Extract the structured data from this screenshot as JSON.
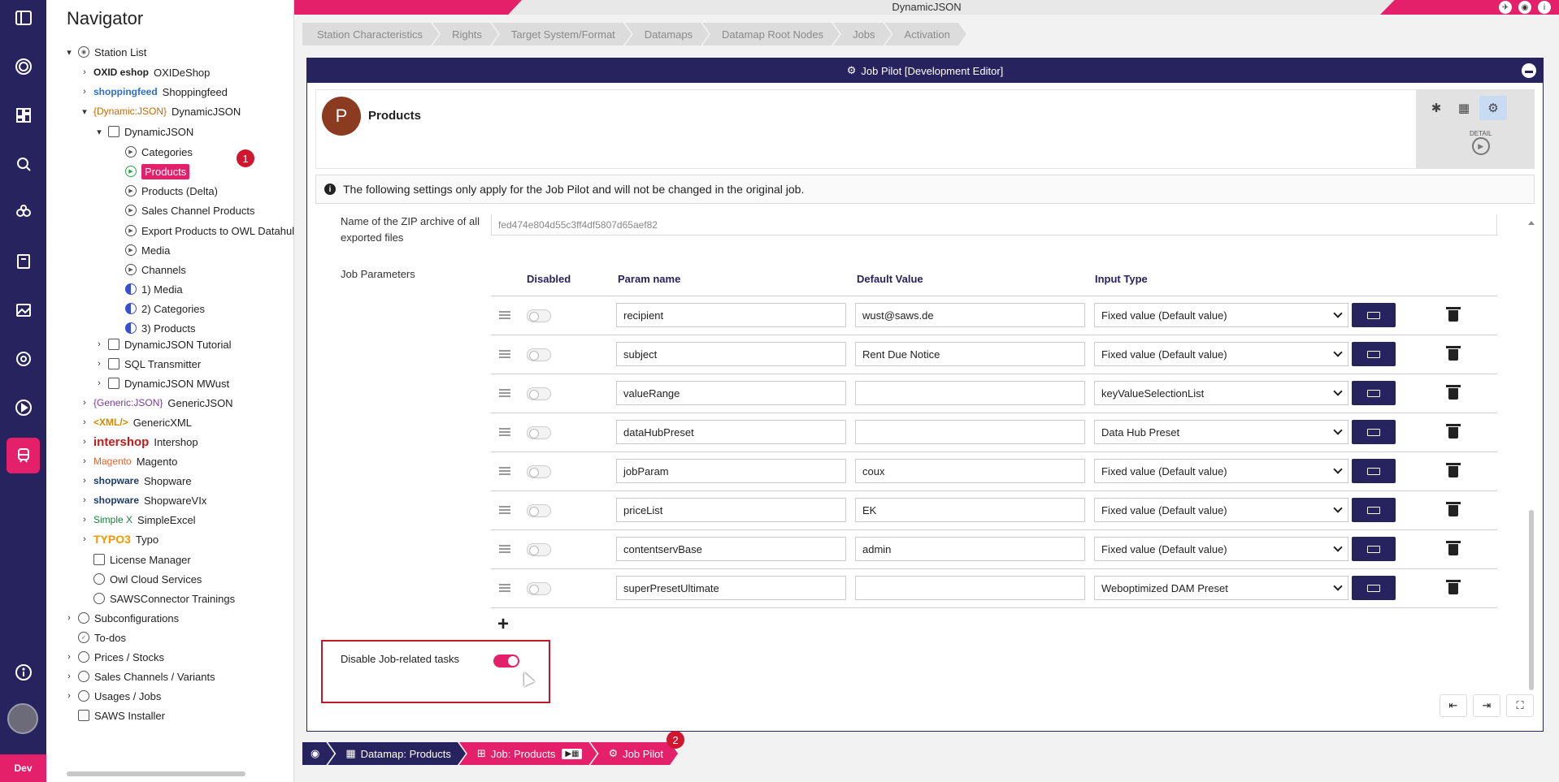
{
  "rail": {
    "icons": [
      "collapse-icon",
      "logo-icon",
      "dashboard-icon",
      "search-icon",
      "connections-icon",
      "book-icon",
      "image-icon",
      "settings-icon",
      "play-icon",
      "station-icon",
      "info-icon"
    ],
    "env": "Dev"
  },
  "nav": {
    "title": "Navigator",
    "items": [
      {
        "label": "Station List"
      },
      {
        "brand": "OXID eshop",
        "label": "OXIDeShop"
      },
      {
        "brand": "shoppingfeed",
        "label": "Shoppingfeed"
      },
      {
        "brand": "{Dynamic:JSON}",
        "label": "DynamicJSON"
      },
      {
        "label": "DynamicJSON"
      },
      {
        "label": "Categories"
      },
      {
        "label": "Products"
      },
      {
        "label": "Products (Delta)"
      },
      {
        "label": "Sales Channel Products"
      },
      {
        "label": "Export Products to OWL Datahul"
      },
      {
        "label": "Media"
      },
      {
        "label": "Channels"
      },
      {
        "label": "1) Media"
      },
      {
        "label": "2) Categories"
      },
      {
        "label": "3) Products"
      },
      {
        "label": "DynamicJSON Tutorial"
      },
      {
        "label": "SQL Transmitter"
      },
      {
        "label": "DynamicJSON MWust"
      },
      {
        "brand": "{Generic:JSON}",
        "label": "GenericJSON"
      },
      {
        "brand": "<XML/>",
        "label": "GenericXML"
      },
      {
        "brand": "intershop",
        "label": "Intershop"
      },
      {
        "brand": "Magento",
        "label": "Magento"
      },
      {
        "brand": "shopware",
        "label": "Shopware"
      },
      {
        "brand": "shopware",
        "label": "ShopwareVIx"
      },
      {
        "brand": "Simple X",
        "label": "SimpleExcel"
      },
      {
        "brand": "TYPO3",
        "label": "Typo"
      },
      {
        "label": "License Manager"
      },
      {
        "label": "Owl Cloud Services"
      },
      {
        "label": "SAWSConnector Trainings"
      },
      {
        "label": "Subconfigurations"
      },
      {
        "label": "To-dos"
      },
      {
        "label": "Prices / Stocks"
      },
      {
        "label": "Sales Channels / Variants"
      },
      {
        "label": "Usages / Jobs"
      },
      {
        "label": "SAWS Installer"
      }
    ],
    "badge1": "1"
  },
  "top": {
    "title": "DynamicJSON"
  },
  "steps": [
    "Station Characteristics",
    "Rights",
    "Target System/Format",
    "Datamaps",
    "Datamap Root Nodes",
    "Jobs",
    "Activation"
  ],
  "panel": {
    "title": "Job Pilot [Development Editor]",
    "job_initial": "P",
    "job_name": "Products",
    "detail_label": "DETAIL",
    "info": "The following settings only apply for the Job Pilot and will not be changed in the original job.",
    "zip_label": "Name of the ZIP archive of all exported files",
    "zip_value": "fed474e804d55c3ff4df5807d65aef82",
    "params_label": "Job Parameters",
    "columns": {
      "disabled": "Disabled",
      "name": "Param name",
      "default": "Default Value",
      "type": "Input Type"
    },
    "params": [
      {
        "name": "recipient",
        "default": "wust@saws.de",
        "type": "Fixed value (Default value)"
      },
      {
        "name": "subject",
        "default": "Rent Due Notice",
        "type": "Fixed value (Default value)"
      },
      {
        "name": "valueRange",
        "default": "",
        "type": "keyValueSelectionList"
      },
      {
        "name": "dataHubPreset",
        "default": "",
        "type": "Data Hub Preset"
      },
      {
        "name": "jobParam",
        "default": "coux",
        "type": "Fixed value (Default value)"
      },
      {
        "name": "priceList",
        "default": "EK",
        "type": "Fixed value (Default value)"
      },
      {
        "name": "contentservBase",
        "default": "admin",
        "type": "Fixed value (Default value)"
      },
      {
        "name": "superPresetUltimate",
        "default": "",
        "type": "Weboptimized DAM Preset"
      }
    ],
    "add": "+",
    "disable_label": "Disable Job-related tasks",
    "disable_on": true
  },
  "crumbs": [
    {
      "label": "Datamap: Products"
    },
    {
      "label": "Job: Products"
    },
    {
      "label": "Job Pilot"
    }
  ],
  "badge2": "2"
}
